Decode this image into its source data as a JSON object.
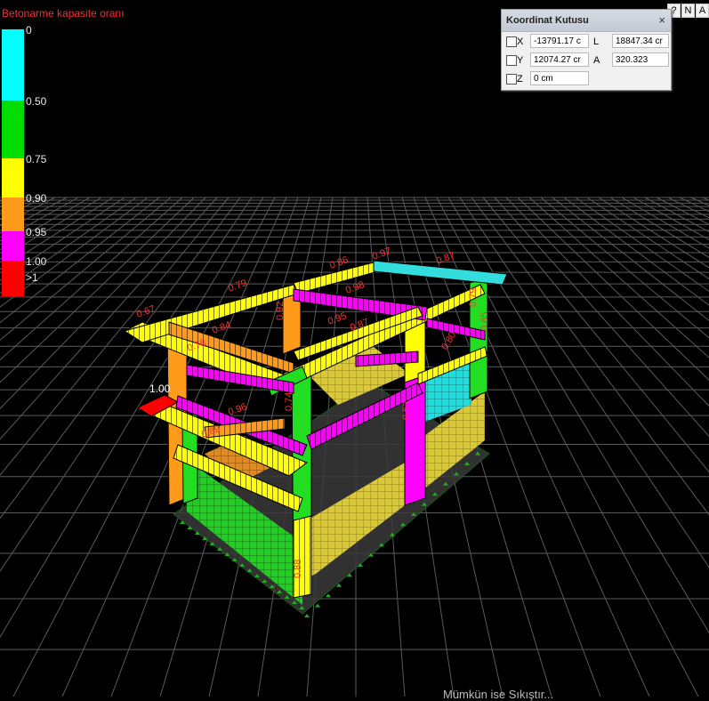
{
  "legend": {
    "title": "Betonarme kapasite oranı",
    "items": [
      {
        "label": "0",
        "color": "#00ffff"
      },
      {
        "label": "0.50",
        "color": "#00dd00"
      },
      {
        "label": "0.75",
        "color": "#ffff00"
      },
      {
        "label": "0.90",
        "color": "#ff9a1a"
      },
      {
        "label": "0.95",
        "color": "#ff00ff"
      },
      {
        "label": "1.00",
        "color": "#ff0000"
      },
      {
        "label": ">1",
        "color": ""
      }
    ]
  },
  "view_buttons": [
    "?",
    "N",
    "A"
  ],
  "coordinate_box": {
    "title": "Koordinat Kutusu",
    "close_label": "×",
    "x_label": "X",
    "x_value": "-13791.17 c",
    "y_label": "Y",
    "y_value": "12074.27 cr",
    "z_label": "Z",
    "z_value": "0 cm",
    "l_label": "L",
    "l_value": "18847.34 cr",
    "a_label": "A",
    "a_value": "320.323"
  },
  "model_labels": {
    "top_labels": [
      "0.67",
      "0.79",
      "0.84",
      "0.92",
      "0.98",
      "0.95",
      "0.86",
      "0.97",
      "0.87",
      "0.79",
      "0.85",
      "0.80",
      "0.87",
      "0.78",
      "0.74",
      "0.96",
      "0.89",
      "0.52",
      "0.88"
    ],
    "highlight_label": "1.00"
  },
  "status": {
    "text": "Mümkün ise Sıkıştır..."
  }
}
